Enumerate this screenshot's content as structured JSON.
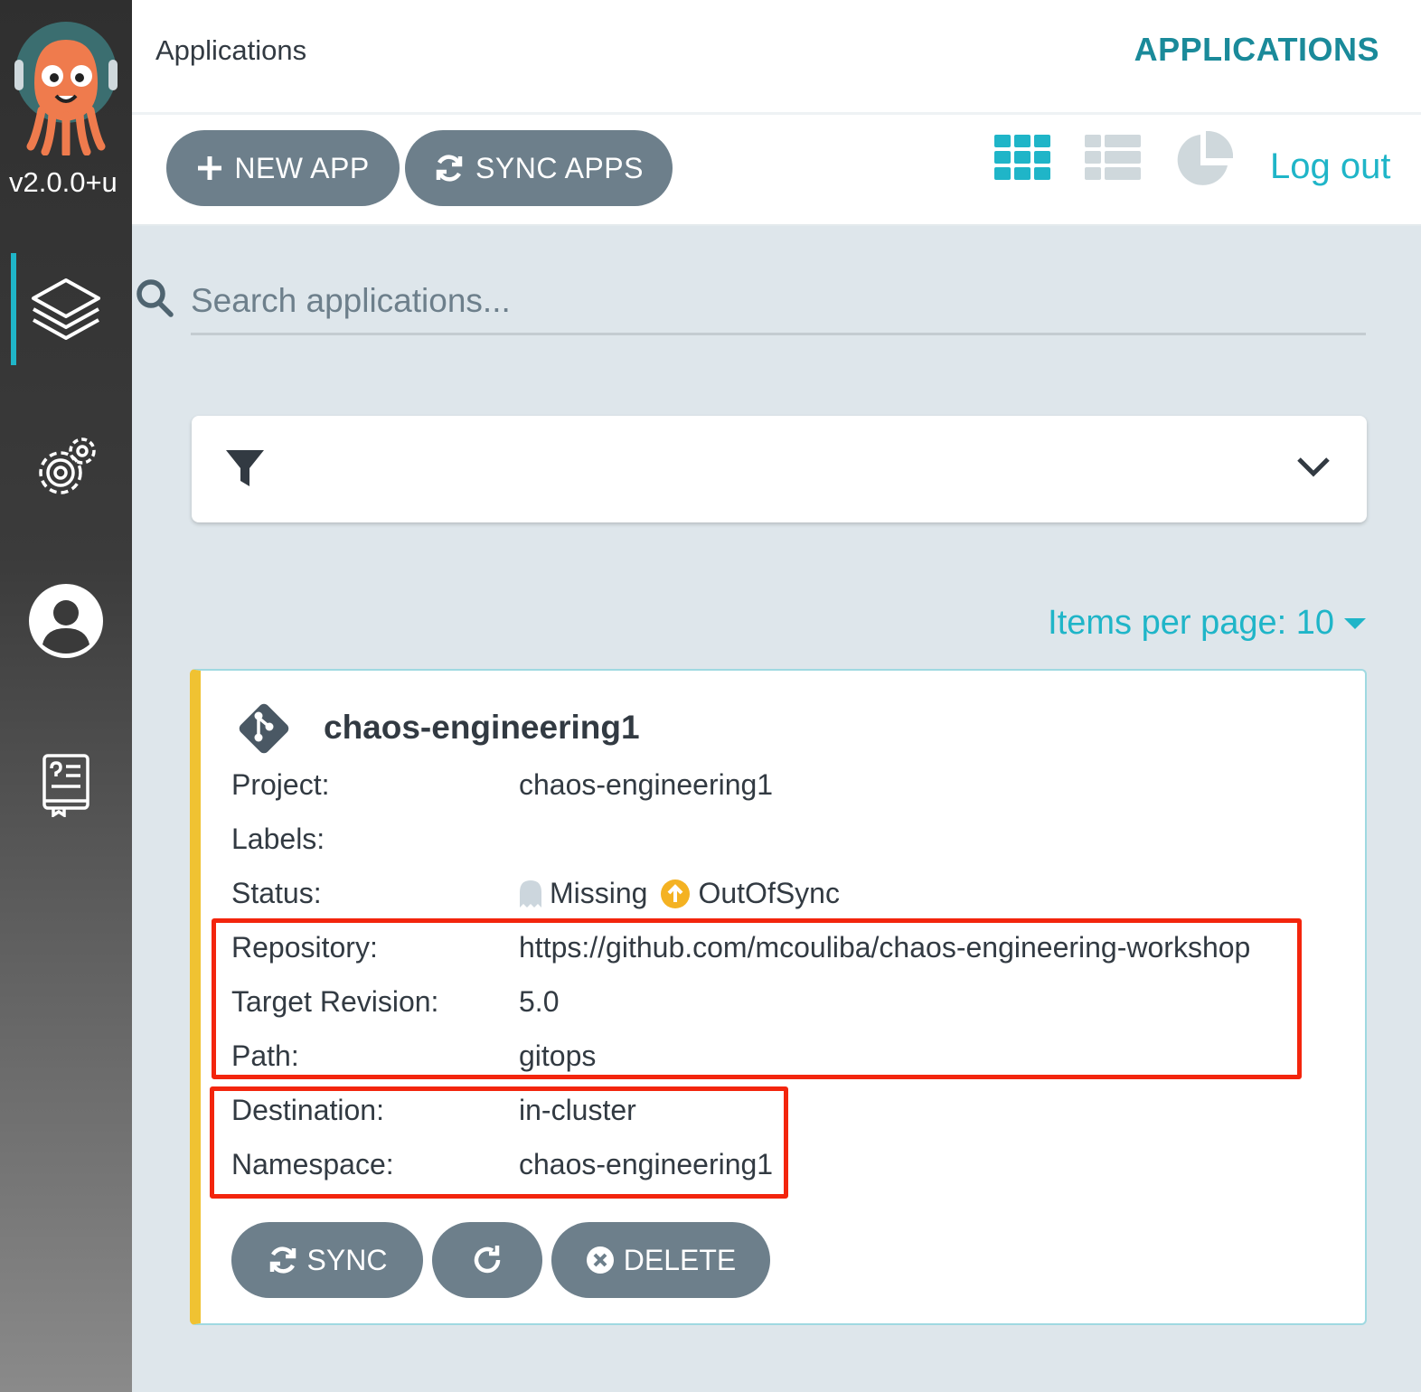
{
  "sidebar": {
    "version": "v2.0.0+u",
    "items": [
      {
        "icon": "layers-icon"
      },
      {
        "icon": "gears-icon"
      },
      {
        "icon": "user-icon"
      },
      {
        "icon": "docs-icon"
      }
    ]
  },
  "header": {
    "title": "Applications",
    "section": "APPLICATIONS"
  },
  "toolbar": {
    "new_app_label": "NEW APP",
    "sync_apps_label": "SYNC APPS",
    "views": [
      "tiles-view-icon",
      "list-view-icon",
      "pie-view-icon"
    ],
    "logout_label": "Log out"
  },
  "search": {
    "placeholder": "Search applications...",
    "value": ""
  },
  "pagination": {
    "items_per_page_label": "Items per page: 10"
  },
  "app": {
    "name": "chaos-engineering1",
    "fields": {
      "project_key": "Project:",
      "project": "chaos-engineering1",
      "labels_key": "Labels:",
      "labels": "",
      "status_key": "Status:",
      "health": "Missing",
      "sync": "OutOfSync",
      "repository_key": "Repository:",
      "repository": "https://github.com/mcouliba/chaos-engineering-workshop",
      "revision_key": "Target Revision:",
      "revision": "5.0",
      "path_key": "Path:",
      "path": "gitops",
      "destination_key": "Destination:",
      "destination": "in-cluster",
      "namespace_key": "Namespace:",
      "namespace": "chaos-engineering1"
    },
    "buttons": {
      "sync": "SYNC",
      "delete": "DELETE"
    }
  },
  "colors": {
    "accent": "#1fb5c8",
    "button": "#6d7f8b",
    "out_of_sync": "#f4b222",
    "highlight": "#f3250d",
    "card_stripe": "#f0c232"
  }
}
